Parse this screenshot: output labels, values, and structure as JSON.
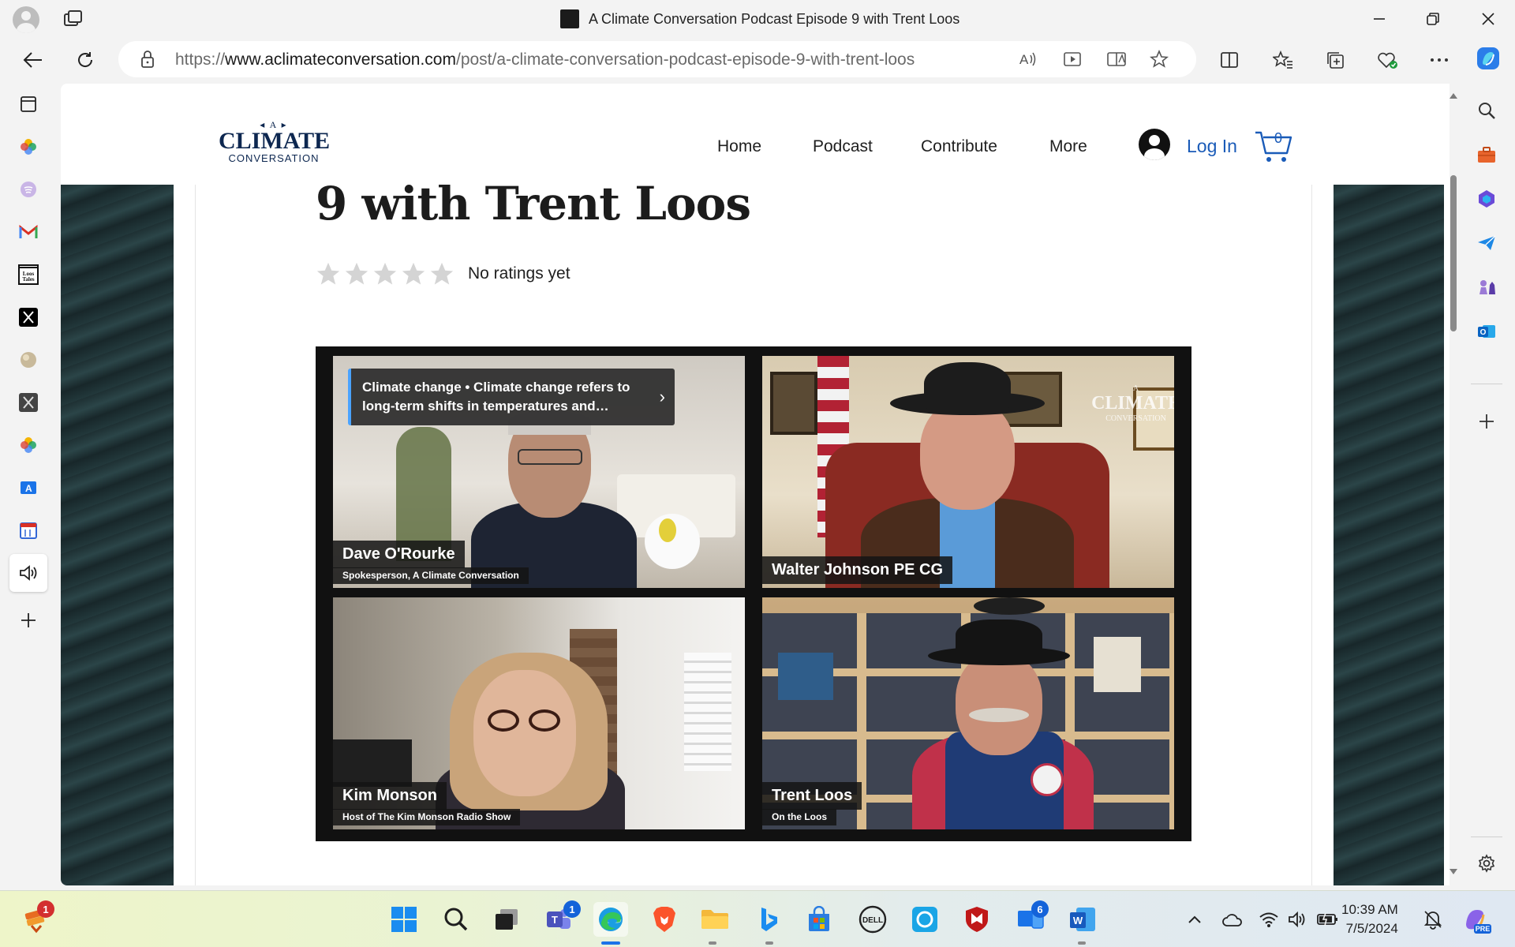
{
  "window": {
    "title": "A Climate Conversation Podcast Episode 9 with Trent Loos"
  },
  "address_bar": {
    "url_prefix": "https://",
    "url_host": "www.aclimateconversation.com",
    "url_path": "/post/a-climate-conversation-podcast-episode-9-with-trent-loos"
  },
  "site": {
    "logo_top": "A",
    "logo_main": "CLIMATE",
    "logo_sub": "CONVERSATION",
    "nav": [
      "Home",
      "Podcast",
      "Contribute",
      "More"
    ],
    "login_label": "Log In",
    "cart_count": "0"
  },
  "post": {
    "title_partial": "9 with Trent Loos",
    "rating_text": "No ratings yet",
    "stars_total": 5,
    "stars_filled": 0
  },
  "video": {
    "caption": "Climate change • Climate change refers to long-term shifts in temperatures and…",
    "watermark_top": "A",
    "watermark_main": "CLIMATE",
    "watermark_sub": "CONVERSATION",
    "participants": [
      {
        "name": "Dave O'Rourke",
        "role": "Spokesperson, A Climate Conversation"
      },
      {
        "name": "Walter Johnson PE CG",
        "role": ""
      },
      {
        "name": "Kim Monson",
        "role": "Host of The Kim Monson Radio Show"
      },
      {
        "name": "Trent Loos",
        "role": "On the Loos"
      }
    ]
  },
  "taskbar": {
    "time": "10:39 AM",
    "date": "7/5/2024",
    "badges": {
      "widgets": "1",
      "teams": "1",
      "phone_link": "6"
    },
    "copilot_label": "PRE"
  },
  "colors": {
    "link_blue": "#1a5bb8",
    "logo_navy": "#0d2750",
    "caption_accent": "#4aa3ff"
  }
}
